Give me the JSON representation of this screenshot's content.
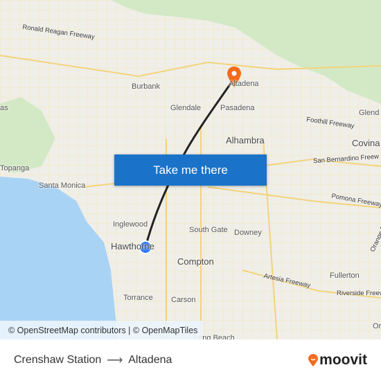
{
  "map": {
    "labels": {
      "reagan": "Ronald Reagan Freeway",
      "calabasas": "as",
      "topanga": "Topanga",
      "burbank": "Burbank",
      "glendale": "Glendale",
      "altadena": "Altadena",
      "pasadena": "Pasadena",
      "alhambra": "Alhambra",
      "foothill": "Foothill Freeway",
      "glendora": "Glend",
      "covina": "Covina",
      "sanbernardino": "San Bernardino Freew",
      "santamonica": "Santa Monica",
      "inglewood": "Inglewood",
      "hawthorne": "Hawthorne",
      "southgate": "South Gate",
      "downey": "Downey",
      "pomona": "Pomona Freeway",
      "orange": "Orange Freew",
      "compton": "Compton",
      "artesia": "Artesia Freeway",
      "fullerton": "Fullerton",
      "riverside": "Riverside Freew",
      "torrance": "Torrance",
      "carson": "Carson",
      "longbeach": "Long Beach",
      "or": "Or"
    },
    "colors": {
      "route": "#222222",
      "origin": "#2979ff",
      "destination_pin": "#f46b1e",
      "water": "#a9d3f5",
      "park": "#cfe8c4"
    },
    "attribution": "© OpenStreetMap contributors | © OpenMapTiles"
  },
  "cta": {
    "label": "Take me there"
  },
  "footer": {
    "origin": "Crenshaw Station",
    "arrow": "⟶",
    "destination": "Altadena",
    "brand": "moovit"
  }
}
